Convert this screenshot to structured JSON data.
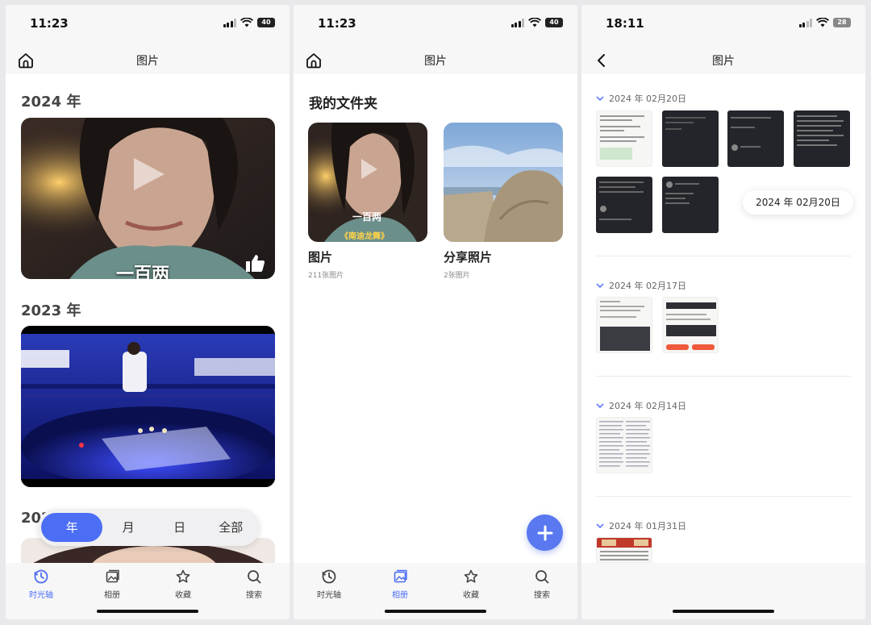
{
  "panel1": {
    "status": {
      "time": "11:23",
      "battery": "40"
    },
    "title": "图片",
    "years": [
      "2024 年",
      "2023 年",
      "2022 年"
    ],
    "card1_text": "一百两",
    "segment": [
      "年",
      "月",
      "日",
      "全部"
    ],
    "segment_active": 0
  },
  "panel2": {
    "status": {
      "time": "11:23",
      "battery": "40"
    },
    "title": "图片",
    "section_title": "我的文件夹",
    "albums": [
      {
        "name": "图片",
        "count": "211张图片",
        "overlay_text": "一百两",
        "overlay_sub": "《南迪龙舞》"
      },
      {
        "name": "分享照片",
        "count": "2张图片"
      }
    ]
  },
  "panel3": {
    "status": {
      "time": "18:11",
      "battery": "28"
    },
    "title": "图片",
    "groups": [
      {
        "date": "2024 年 02月20日"
      },
      {
        "date": "2024 年 02月17日"
      },
      {
        "date": "2024 年 02月14日"
      },
      {
        "date": "2024 年 01月31日"
      }
    ],
    "floating_date": "2024 年 02月20日"
  },
  "tabs": [
    "时光轴",
    "相册",
    "收藏",
    "搜索"
  ],
  "tab_icons": [
    "clock-icon",
    "album-icon",
    "star-icon",
    "search-icon"
  ],
  "accent": "#4c6ef5"
}
